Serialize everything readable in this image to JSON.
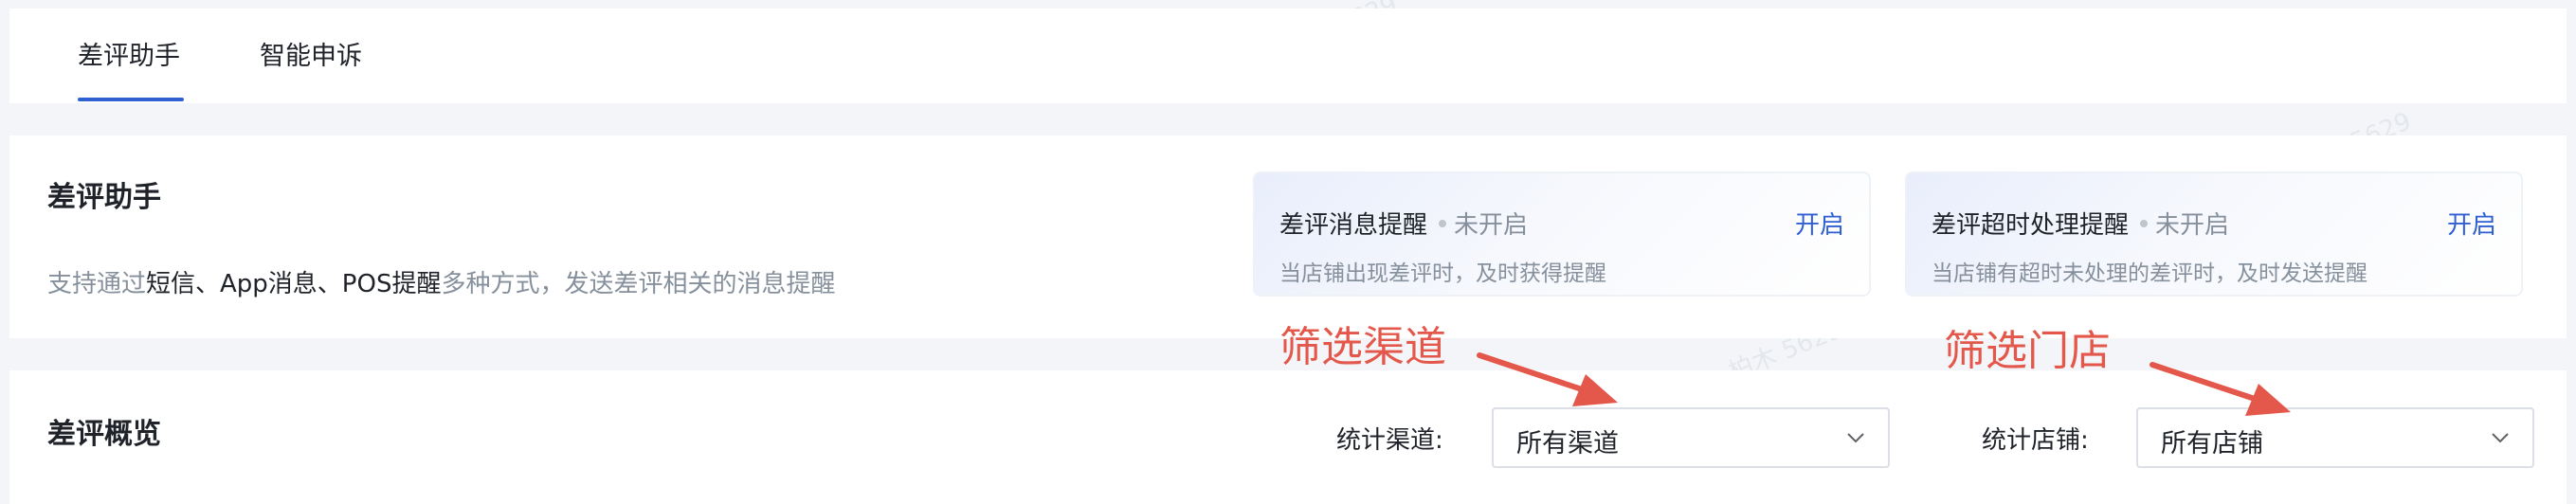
{
  "tabs": [
    {
      "label": "差评助手",
      "active": true
    },
    {
      "label": "智能申诉",
      "active": false
    }
  ],
  "helper": {
    "title": "差评助手",
    "desc_prefix": "支持通过",
    "desc_highlight": "短信、App消息、POS提醒",
    "desc_suffix": "多种方式，发送差评相关的消息提醒",
    "cards": [
      {
        "title": "差评消息提醒",
        "status": "未开启",
        "action": "开启",
        "desc": "当店铺出现差评时，及时获得提醒"
      },
      {
        "title": "差评超时处理提醒",
        "status": "未开启",
        "action": "开启",
        "desc": "当店铺有超时未处理的差评时，及时发送提醒"
      }
    ]
  },
  "overview": {
    "title": "差评概览",
    "channel_filter": {
      "label": "统计渠道:",
      "value": "所有渠道"
    },
    "store_filter": {
      "label": "统计店铺:",
      "value": "所有店铺"
    }
  },
  "annotations": [
    {
      "text": "筛选渠道"
    },
    {
      "text": "筛选门店"
    }
  ],
  "watermark": "柏木 5629",
  "colors": {
    "accent": "#2f5fd0",
    "annotation": "#e4574b"
  },
  "icons": {
    "select_chevron": "chevron-down-icon"
  }
}
